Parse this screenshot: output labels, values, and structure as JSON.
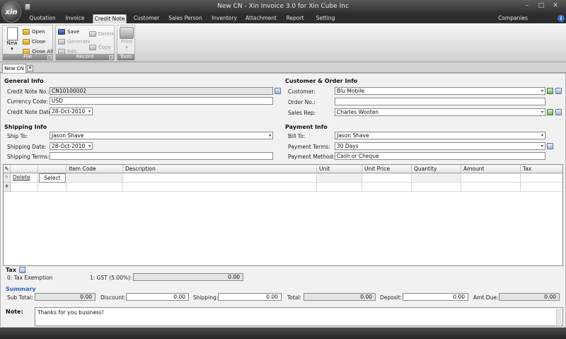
{
  "window": {
    "title": "New CN - Xin Invoice 3.0 for Xin Cube Inc",
    "logo_text": "xin",
    "min": "–",
    "max": "□",
    "close": "✕"
  },
  "ribbon_tabs": [
    "Quotation",
    "Invoice",
    "Credit Note",
    "Customer",
    "Sales Person",
    "Inventory",
    "Attachment",
    "Report",
    "Setting",
    "Companies"
  ],
  "active_tab": "Credit Note",
  "ribbon": {
    "file": {
      "label": "File",
      "new": "New",
      "open": "Open",
      "close": "Close",
      "close_all": "Close All"
    },
    "record": {
      "label": "Record",
      "save": "Save",
      "generate": "Generate",
      "edit": "Edit",
      "delete": "Delete",
      "copy": "Copy"
    },
    "tools": {
      "label": "Tools",
      "print": "Print"
    }
  },
  "doc_tab": {
    "label": "New CN",
    "close": "✕"
  },
  "general": {
    "heading": "General Info",
    "cn_no_label": "Credit Note No.:",
    "cn_no": "CN10100002",
    "currency_label": "Currency Code:",
    "currency": "USD",
    "cn_date_label": "Credit Note Date:",
    "cn_date": "28-Oct-2010"
  },
  "customer": {
    "heading": "Customer & Order Info",
    "customer_label": "Customer:",
    "customer": "Blu Mobile",
    "order_label": "Order No.:",
    "order": "",
    "rep_label": "Sales Rep:",
    "rep": "Charles Wooten"
  },
  "shipping": {
    "heading": "Shipping Info",
    "ship_to_label": "Ship To:",
    "ship_to": "Jason Shave",
    "ship_date_label": "Shipping Date:",
    "ship_date": "28-Oct-2010",
    "terms_label": "Shipping Terms:",
    "terms": ""
  },
  "payment": {
    "heading": "Payment Info",
    "bill_to_label": "Bill To:",
    "bill_to": "Jason Shave",
    "terms_label": "Payment Terms:",
    "terms": "30 Days",
    "method_label": "Payment Method:",
    "method": "Cash or Cheque"
  },
  "grid": {
    "columns": [
      "Item Code",
      "Description",
      "Unit",
      "Unit Price",
      "Quantity",
      "Amount",
      "Tax"
    ],
    "row1": {
      "delete": "Delete",
      "select": "Select"
    }
  },
  "tax": {
    "heading": "Tax",
    "exempt": "0: Tax Exemption",
    "gst_label": "1: GST (5.00%):",
    "gst": "0.00"
  },
  "summary": {
    "heading": "Summary",
    "subtotal_label": "Sub Total:",
    "subtotal": "0.00",
    "discount_label": "Discount:",
    "discount": "0.00",
    "shipping_label": "Shipping:",
    "shipping": "0.00",
    "total_label": "Total:",
    "total": "0.00",
    "deposit_label": "Deposit:",
    "deposit": "0.00",
    "amtdue_label": "Amt Due:",
    "amtdue": "0.00"
  },
  "note": {
    "label": "Note:",
    "text": "Thanks for you business!"
  }
}
